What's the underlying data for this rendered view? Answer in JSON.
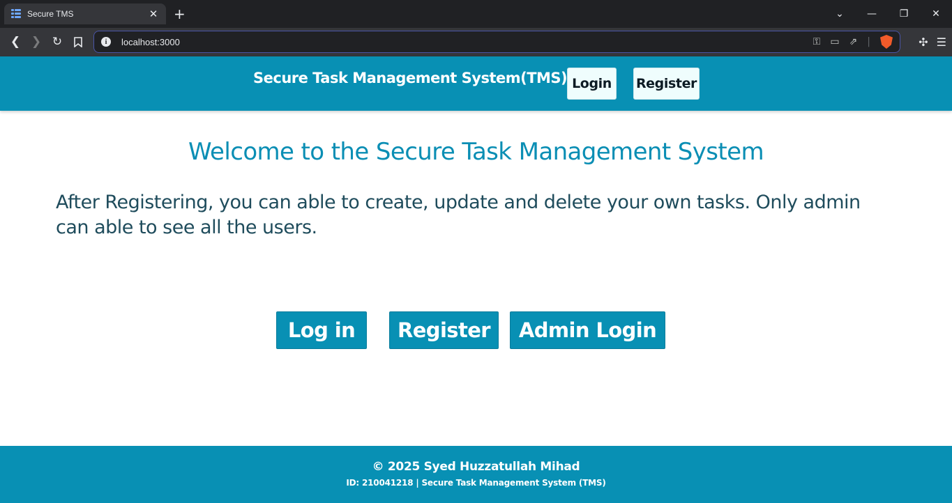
{
  "browser": {
    "tab_title": "Secure TMS",
    "tab_close": "✕",
    "new_tab": "+",
    "url": "localhost:3000",
    "icons": [
      "grid-favicon",
      "back-icon",
      "forward-icon",
      "reload-icon",
      "bookmark-icon",
      "site-info-icon",
      "key-icon",
      "cast-icon",
      "share-icon",
      "brave-shield-icon",
      "extensions-icon",
      "menu-icon"
    ]
  },
  "header": {
    "title": "Secure Task Management System(TMS)",
    "login_label": "Login",
    "register_label": "Register"
  },
  "main": {
    "heading": "Welcome to the Secure Task Management System",
    "description": "After Registering, you can able to create, update and delete your own tasks. Only admin can able to see all the users.",
    "buttons": {
      "login": "Log in",
      "register": "Register",
      "admin_login": "Admin Login"
    }
  },
  "footer": {
    "copyright": "© 2025 Syed Huzzatullah Mihad",
    "id_line": "ID: 210041218 | Secure Task Management System (TMS)"
  },
  "colors": {
    "accent": "#0890b4",
    "heading_text": "#0a8eb4",
    "body_text": "#1f4c5c",
    "header_button_bg": "#effdfd"
  }
}
